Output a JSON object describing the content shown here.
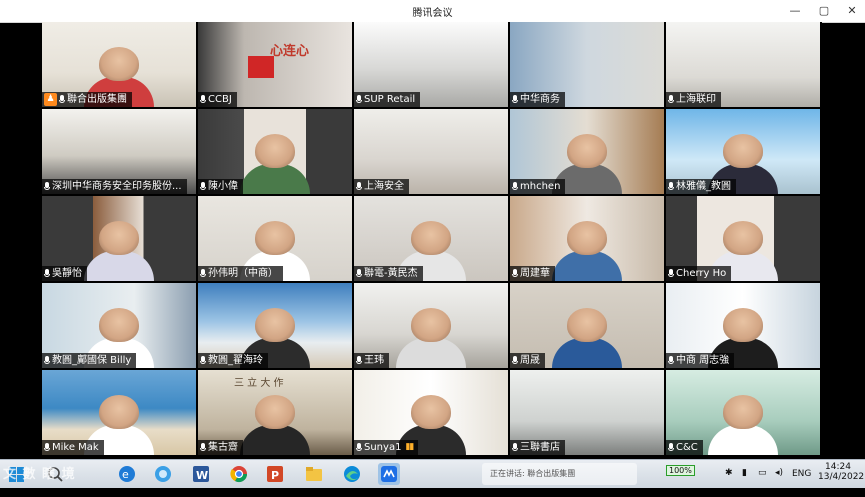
{
  "window": {
    "title": "腾讯会议",
    "min": "—",
    "max": "▢",
    "close": "✕"
  },
  "participants": [
    {
      "name": "聯合出版集團",
      "host": true,
      "mic": true
    },
    {
      "name": "CCBJ",
      "mic": true
    },
    {
      "name": "SUP Retail",
      "mic": true
    },
    {
      "name": "中华商务",
      "mic": true
    },
    {
      "name": "上海联印",
      "mic": true
    },
    {
      "name": "深圳中华商务安全印务股份...",
      "mic": true
    },
    {
      "name": "陳小偉",
      "mic": true
    },
    {
      "name": "上海安全",
      "mic": true
    },
    {
      "name": "mhchen",
      "mic": true
    },
    {
      "name": "林雅儀_教圓",
      "mic": true
    },
    {
      "name": "吳靜怡",
      "mic": true
    },
    {
      "name": "孙伟明（中商）",
      "mic": true
    },
    {
      "name": "聯電-黃民杰",
      "mic": true
    },
    {
      "name": "周建華",
      "mic": true
    },
    {
      "name": "Cherry Ho",
      "mic": true
    },
    {
      "name": "教圓_鄺國保 Billy",
      "mic": true
    },
    {
      "name": "教圓_翟海玲",
      "mic": true
    },
    {
      "name": "王玮",
      "mic": true
    },
    {
      "name": "周晟",
      "mic": true
    },
    {
      "name": "中商 周志強",
      "mic": true
    },
    {
      "name": "Mike Mak",
      "mic": true
    },
    {
      "name": "集古齋",
      "mic": true
    },
    {
      "name": "Sunya1",
      "mic": true,
      "speaking": true
    },
    {
      "name": "三聯書店",
      "mic": true
    },
    {
      "name": "C&C",
      "mic": true
    }
  ],
  "wall_text": {
    "slogan": "心连心",
    "calligraphy": "三 立 大 作"
  },
  "taskbar": {
    "status_text": "正在讲话: 聯合出版集團",
    "battery": "100%",
    "language": "ENG",
    "time": "14:24",
    "date": "13/4/2022",
    "watermark": "文 數 瞎 境"
  }
}
